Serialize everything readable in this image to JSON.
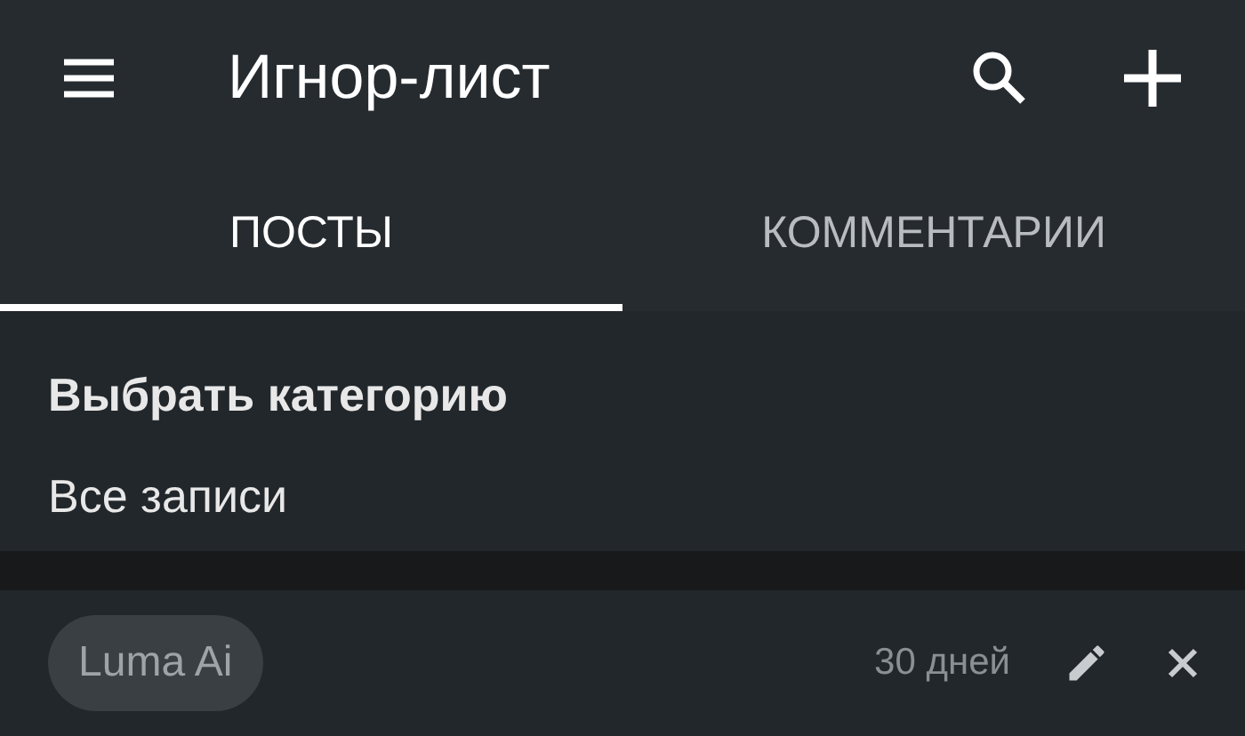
{
  "app_bar": {
    "title": "Игнор-лист"
  },
  "tabs": [
    {
      "label": "ПОСТЫ",
      "selected": true
    },
    {
      "label": "КОММЕНТАРИИ",
      "selected": false
    }
  ],
  "category": {
    "label": "Выбрать категорию",
    "value": "Все записи"
  },
  "entries": [
    {
      "name": "Luma Ai",
      "age": "30 дней"
    }
  ]
}
